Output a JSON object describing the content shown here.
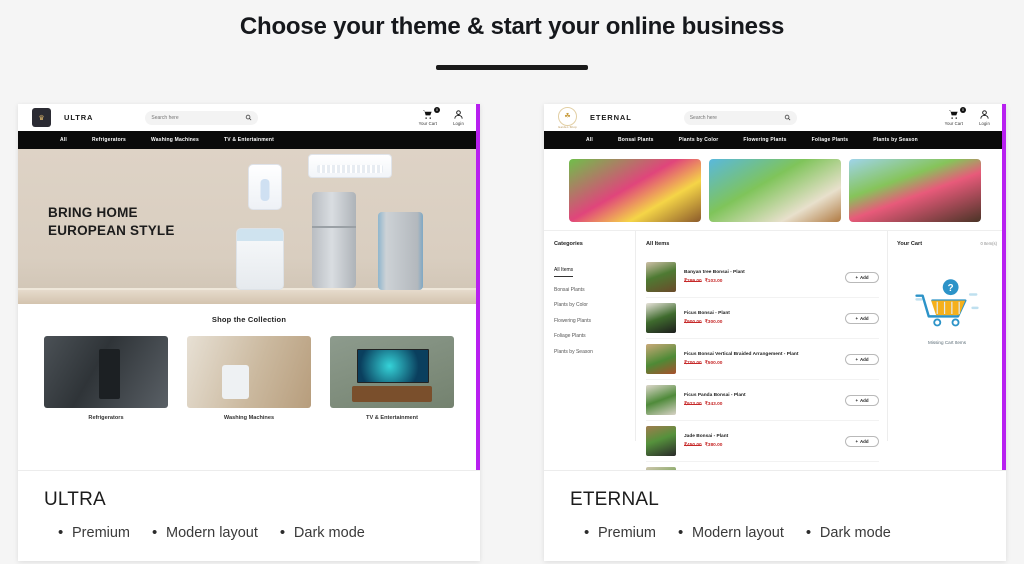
{
  "header": {
    "title": "Choose your theme & start your online business"
  },
  "themes": [
    {
      "name": "ULTRA",
      "features": [
        "Premium",
        "Modern layout",
        "Dark mode"
      ],
      "store": {
        "brand": "ULTRA",
        "search_placeholder": "Search here",
        "cart_label": "Your Cart",
        "cart_badge": "0",
        "login_label": "Login",
        "nav": [
          "All",
          "Refrigerators",
          "Washing Machines",
          "TV & Entertainment"
        ],
        "hero_line1": "BRING HOME",
        "hero_line2": "EUROPEAN STYLE",
        "collection_title": "Shop the Collection",
        "tiles": [
          "Refrigerators",
          "Washing Machines",
          "TV & Entertainment"
        ]
      }
    },
    {
      "name": "ETERNAL",
      "features": [
        "Premium",
        "Modern layout",
        "Dark mode"
      ],
      "store": {
        "brand": "ETERNAL",
        "brand_sub": "Garden Shop",
        "search_placeholder": "Search here",
        "cart_label": "Your Cart",
        "cart_badge": "0",
        "login_label": "Login",
        "nav": [
          "All",
          "Bonsai Plants",
          "Plants by Color",
          "Flowering Plants",
          "Foliage Plants",
          "Plants by Season"
        ],
        "categories_title": "Categories",
        "categories": [
          "All Items",
          "Bonsai Plants",
          "Plants by Color",
          "Flowering Plants",
          "Foliage Plants",
          "Plants by Season"
        ],
        "items_title": "All Items",
        "add_label": "Add",
        "products": [
          {
            "name": "Banyan tree Bonsai - Plant",
            "old_price": "₹299.00",
            "new_price": "₹103.00"
          },
          {
            "name": "Ficus Bonsai - Plant",
            "old_price": "₹900.00",
            "new_price": "₹300.00"
          },
          {
            "name": "Ficus Bonsai Vertical Braided Arrangement - Plant",
            "old_price": "₹700.00",
            "new_price": "₹500.00"
          },
          {
            "name": "Ficus Panda Bonsai - Plant",
            "old_price": "₹923.00",
            "new_price": "₹343.00"
          },
          {
            "name": "Jade Bonsai - Plant",
            "old_price": "₹450.00",
            "new_price": "₹380.00"
          }
        ],
        "cart_panel_title": "Your Cart",
        "cart_panel_count": "0 Item(s)",
        "cart_empty_text": "Missing Cart Items"
      }
    }
  ],
  "colors": {
    "page_bg": "#f5f5f5",
    "card_bg": "#ffffff",
    "scrollbar": "#b820f0",
    "nav_bg": "#0a0a0a",
    "price": "#c62828"
  },
  "icons": {
    "search": "search-icon",
    "cart": "cart-icon",
    "user": "user-icon",
    "plus": "plus-icon"
  }
}
